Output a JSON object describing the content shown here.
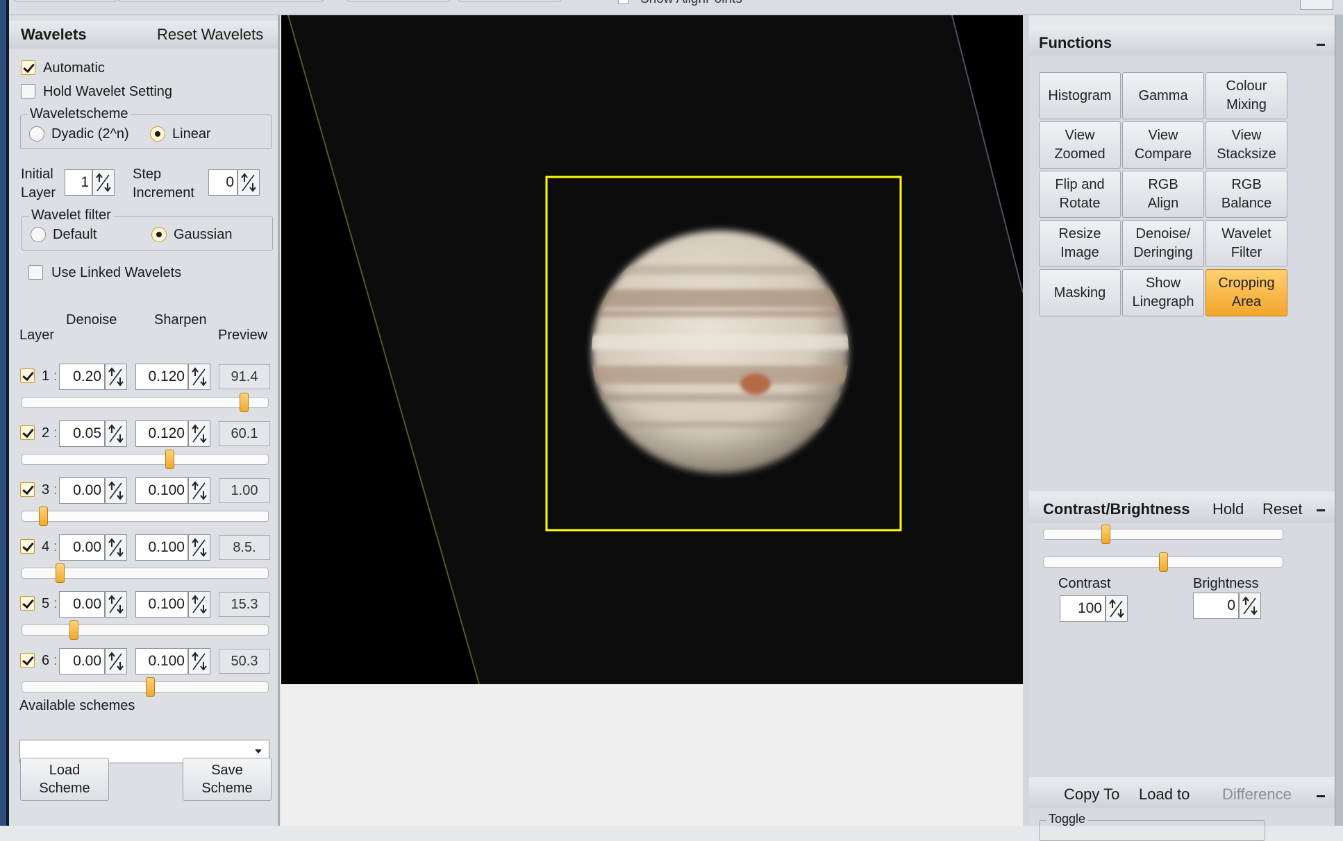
{
  "top_bar": {
    "show_align_points_label": "Show AlignPoints"
  },
  "wavelets": {
    "title": "Wavelets",
    "reset_label": "Reset Wavelets",
    "automatic_label": "Automatic",
    "automatic_checked": true,
    "hold_label": "Hold Wavelet Setting",
    "hold_checked": false,
    "scheme_group_label": "Waveletscheme",
    "dyadic_label": "Dyadic (2^n)",
    "linear_label": "Linear",
    "selected_scheme": "Linear",
    "initial_label_1": "Initial",
    "initial_label_2": "Layer",
    "initial_value": "1",
    "step_label_1": "Step",
    "step_label_2": "Increment",
    "step_value": "0",
    "filter_group_label": "Wavelet filter",
    "default_label": "Default",
    "gaussian_label": "Gaussian",
    "selected_filter": "Gaussian",
    "linked_label": "Use Linked Wavelets",
    "linked_checked": false,
    "col_layer": "Layer",
    "col_denoise": "Denoise",
    "col_sharpen": "Sharpen",
    "col_preview": "Preview",
    "layers": [
      {
        "num": "1",
        "checked": true,
        "denoise": "0.20",
        "sharpen": "0.120",
        "preview": "91.4",
        "slider_pct": 91.4
      },
      {
        "num": "2",
        "checked": true,
        "denoise": "0.05",
        "sharpen": "0.120",
        "preview": "60.1",
        "slider_pct": 60.1
      },
      {
        "num": "3",
        "checked": true,
        "denoise": "0.00",
        "sharpen": "0.100",
        "preview": "1.00",
        "slider_pct": 7
      },
      {
        "num": "4",
        "checked": true,
        "denoise": "0.00",
        "sharpen": "0.100",
        "preview": "8.5.",
        "slider_pct": 14
      },
      {
        "num": "5",
        "checked": true,
        "denoise": "0.00",
        "sharpen": "0.100",
        "preview": "15.3",
        "slider_pct": 20
      },
      {
        "num": "6",
        "checked": true,
        "denoise": "0.00",
        "sharpen": "0.100",
        "preview": "50.3",
        "slider_pct": 52
      }
    ],
    "available_schemes_label": "Available schemes",
    "scheme_dropdown_value": "",
    "load_scheme_line1": "Load",
    "load_scheme_line2": "Scheme",
    "save_scheme_line1": "Save",
    "save_scheme_line2": "Scheme"
  },
  "functions": {
    "title": "Functions",
    "buttons": [
      {
        "line1": "Histogram",
        "line2": "",
        "active": false
      },
      {
        "line1": "Gamma",
        "line2": "",
        "active": false
      },
      {
        "line1": "Colour",
        "line2": "Mixing",
        "active": false
      },
      {
        "line1": "View",
        "line2": "Zoomed",
        "active": false
      },
      {
        "line1": "View",
        "line2": "Compare",
        "active": false
      },
      {
        "line1": "View",
        "line2": "Stacksize",
        "active": false
      },
      {
        "line1": "Flip and",
        "line2": "Rotate",
        "active": false
      },
      {
        "line1": "RGB",
        "line2": "Align",
        "active": false
      },
      {
        "line1": "RGB",
        "line2": "Balance",
        "active": false
      },
      {
        "line1": "Resize",
        "line2": "Image",
        "active": false
      },
      {
        "line1": "Denoise/",
        "line2": "Deringing",
        "active": false
      },
      {
        "line1": "Wavelet",
        "line2": "Filter",
        "active": false
      },
      {
        "line1": "Masking",
        "line2": "",
        "active": false
      },
      {
        "line1": "Show",
        "line2": "Linegraph",
        "active": false
      },
      {
        "line1": "Cropping",
        "line2": "Area",
        "active": true
      }
    ]
  },
  "contrast_brightness": {
    "title": "Contrast/Brightness",
    "hold_label": "Hold",
    "reset_label": "Reset",
    "contrast_label": "Contrast",
    "contrast_value": "100",
    "brightness_label": "Brightness",
    "brightness_value": "0"
  },
  "bottom_panel": {
    "copy_to_label": "Copy To",
    "load_to_label": "Load to",
    "difference_label": "Difference",
    "toggle_label": "Toggle"
  },
  "colors": {
    "accent_orange": "#f3a62a",
    "crop_frame": "#ffff00",
    "panel_bg": "#dcdfe4"
  }
}
